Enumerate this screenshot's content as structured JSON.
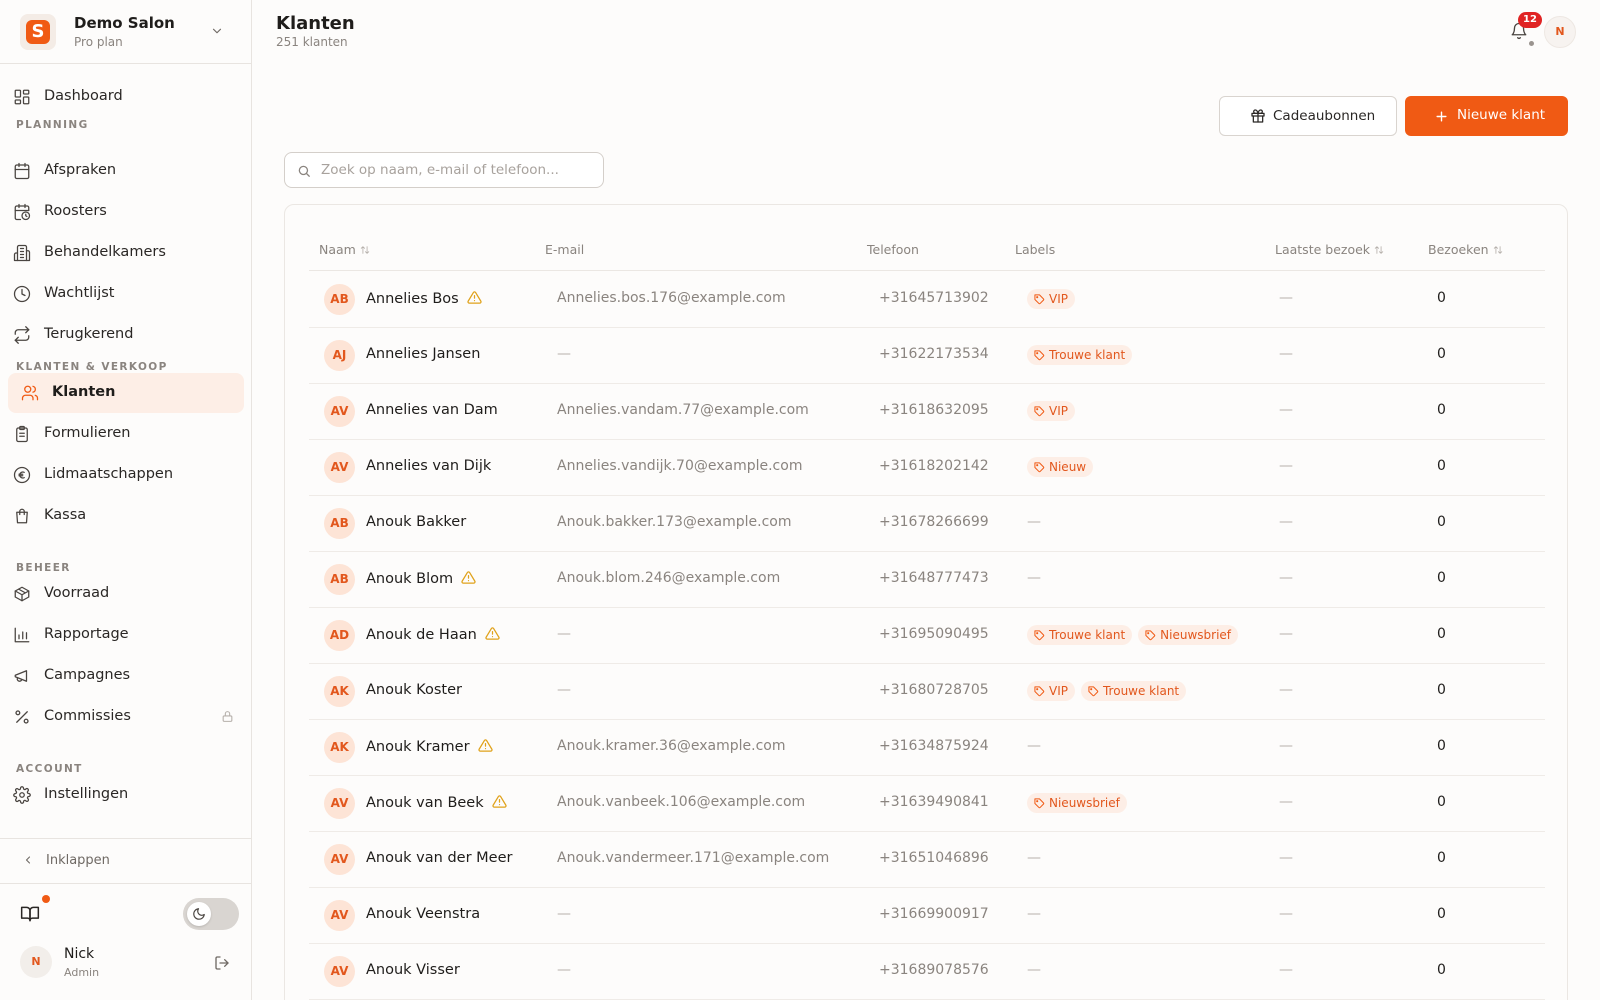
{
  "sidebar": {
    "logo_letter": "S",
    "salon_name": "Demo Salon",
    "salon_plan": "Pro plan",
    "top_item": {
      "label": "Dashboard",
      "icon": "grid-icon"
    },
    "sections": [
      {
        "title": "PLANNING",
        "items": [
          {
            "label": "Afspraken",
            "icon": "calendar-icon"
          },
          {
            "label": "Roosters",
            "icon": "calendar-clock-icon"
          },
          {
            "label": "Behandelkamers",
            "icon": "building-icon"
          },
          {
            "label": "Wachtlijst",
            "icon": "clock-icon"
          },
          {
            "label": "Terugkerend",
            "icon": "repeat-icon"
          }
        ]
      },
      {
        "title": "KLANTEN & VERKOOP",
        "items": [
          {
            "label": "Klanten",
            "icon": "users-icon",
            "active": true
          },
          {
            "label": "Formulieren",
            "icon": "clipboard-icon"
          },
          {
            "label": "Lidmaatschappen",
            "icon": "euro-icon"
          },
          {
            "label": "Kassa",
            "icon": "shopping-bag-icon"
          }
        ]
      },
      {
        "title": "BEHEER",
        "items": [
          {
            "label": "Voorraad",
            "icon": "package-icon"
          },
          {
            "label": "Rapportage",
            "icon": "bar-chart-icon"
          },
          {
            "label": "Campagnes",
            "icon": "megaphone-icon"
          },
          {
            "label": "Commissies",
            "icon": "percent-icon",
            "locked": true
          }
        ]
      },
      {
        "title": "ACCOUNT",
        "items": [
          {
            "label": "Instellingen",
            "icon": "gear-icon"
          }
        ]
      }
    ],
    "collapse_label": "Inklappen",
    "user": {
      "initial": "N",
      "name": "Nick",
      "role": "Admin"
    }
  },
  "header": {
    "title": "Klanten",
    "subtitle": "251 klanten",
    "notification_count": "12",
    "avatar_initial": "N"
  },
  "actions": {
    "gift_label": "Cadeaubonnen",
    "new_label": "Nieuwe klant"
  },
  "search": {
    "placeholder": "Zoek op naam, e-mail of telefoon...",
    "value": ""
  },
  "table": {
    "columns": [
      "Naam",
      "E-mail",
      "Telefoon",
      "Labels",
      "Laatste bezoek",
      "Bezoeken"
    ],
    "sortable": [
      "Naam",
      "Laatste bezoek",
      "Bezoeken"
    ],
    "empty": "—",
    "rows": [
      {
        "initials": "AB",
        "name": "Annelies Bos",
        "warning": true,
        "email": "Annelies.bos.176@example.com",
        "phone": "+31645713902",
        "labels": [
          "VIP"
        ],
        "last_visit": "—",
        "visits": "0"
      },
      {
        "initials": "AJ",
        "name": "Annelies Jansen",
        "warning": false,
        "email": "—",
        "phone": "+31622173534",
        "labels": [
          "Trouwe klant"
        ],
        "last_visit": "—",
        "visits": "0"
      },
      {
        "initials": "AV",
        "name": "Annelies van Dam",
        "warning": false,
        "email": "Annelies.vandam.77@example.com",
        "phone": "+31618632095",
        "labels": [
          "VIP"
        ],
        "last_visit": "—",
        "visits": "0"
      },
      {
        "initials": "AV",
        "name": "Annelies van Dijk",
        "warning": false,
        "email": "Annelies.vandijk.70@example.com",
        "phone": "+31618202142",
        "labels": [
          "Nieuw"
        ],
        "last_visit": "—",
        "visits": "0"
      },
      {
        "initials": "AB",
        "name": "Anouk Bakker",
        "warning": false,
        "email": "Anouk.bakker.173@example.com",
        "phone": "+31678266699",
        "labels": [],
        "last_visit": "—",
        "visits": "0"
      },
      {
        "initials": "AB",
        "name": "Anouk Blom",
        "warning": true,
        "email": "Anouk.blom.246@example.com",
        "phone": "+31648777473",
        "labels": [],
        "last_visit": "—",
        "visits": "0"
      },
      {
        "initials": "AD",
        "name": "Anouk de Haan",
        "warning": true,
        "email": "—",
        "phone": "+31695090495",
        "labels": [
          "Trouwe klant",
          "Nieuwsbrief"
        ],
        "last_visit": "—",
        "visits": "0"
      },
      {
        "initials": "AK",
        "name": "Anouk Koster",
        "warning": false,
        "email": "—",
        "phone": "+31680728705",
        "labels": [
          "VIP",
          "Trouwe klant"
        ],
        "last_visit": "—",
        "visits": "0"
      },
      {
        "initials": "AK",
        "name": "Anouk Kramer",
        "warning": true,
        "email": "Anouk.kramer.36@example.com",
        "phone": "+31634875924",
        "labels": [],
        "last_visit": "—",
        "visits": "0"
      },
      {
        "initials": "AV",
        "name": "Anouk van Beek",
        "warning": true,
        "email": "Anouk.vanbeek.106@example.com",
        "phone": "+31639490841",
        "labels": [
          "Nieuwsbrief"
        ],
        "last_visit": "—",
        "visits": "0"
      },
      {
        "initials": "AV",
        "name": "Anouk van der Meer",
        "warning": false,
        "email": "Anouk.vandermeer.171@example.com",
        "phone": "+31651046896",
        "labels": [],
        "last_visit": "—",
        "visits": "0"
      },
      {
        "initials": "AV",
        "name": "Anouk Veenstra",
        "warning": false,
        "email": "—",
        "phone": "+31669900917",
        "labels": [],
        "last_visit": "—",
        "visits": "0"
      },
      {
        "initials": "AV",
        "name": "Anouk Visser",
        "warning": false,
        "email": "—",
        "phone": "+31689078576",
        "labels": [],
        "last_visit": "—",
        "visits": "0"
      }
    ]
  },
  "colors": {
    "accent": "#f05a14",
    "accent_soft": "#fdeee6",
    "warning": "#e0a21b",
    "badge": "#e02424"
  }
}
